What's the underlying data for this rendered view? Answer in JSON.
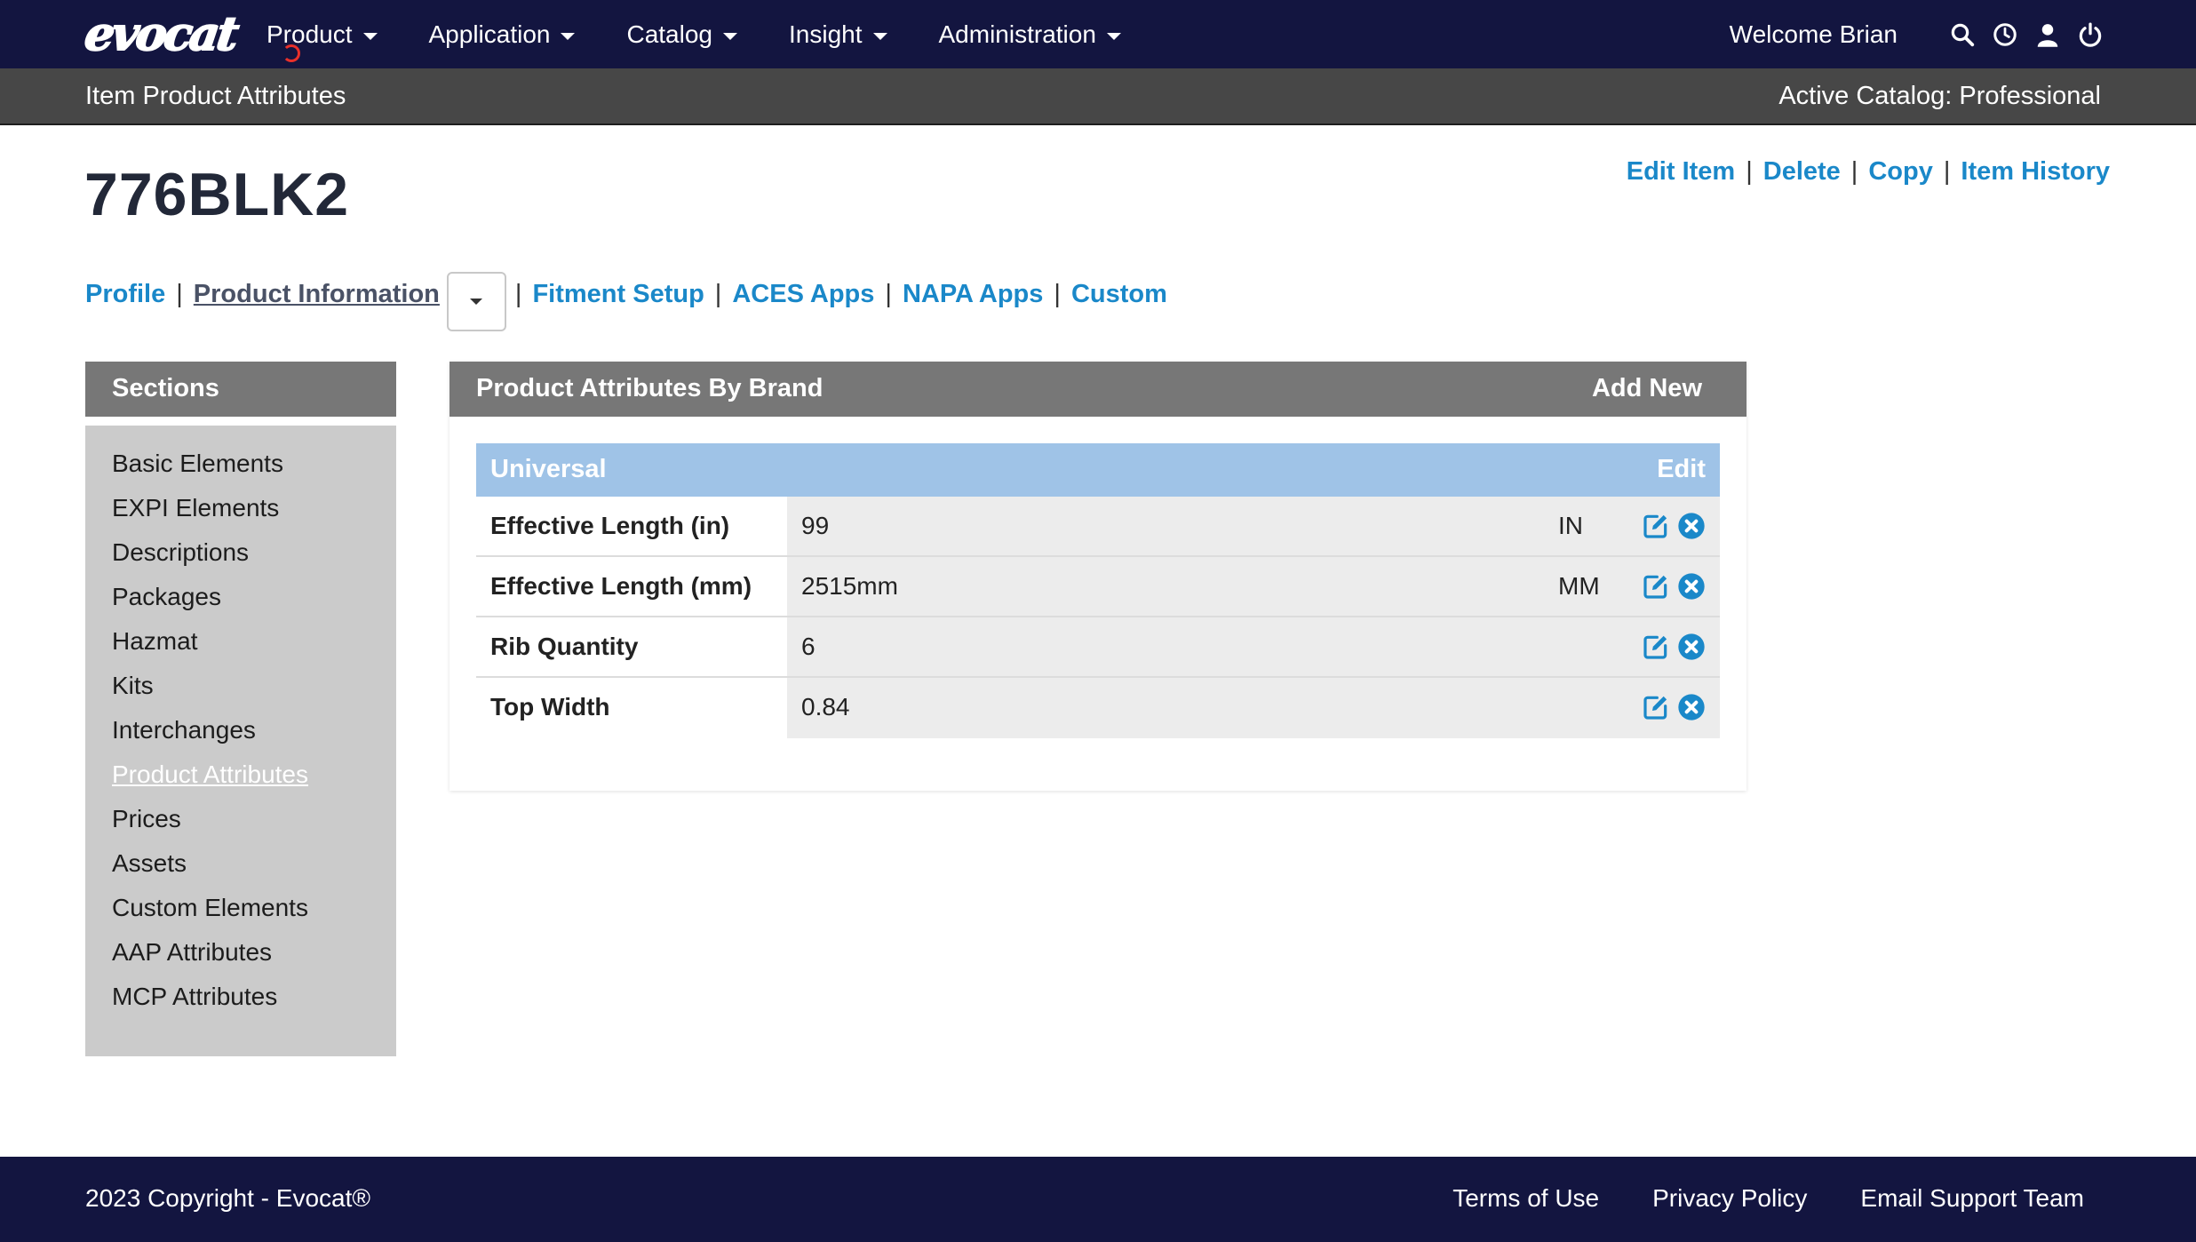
{
  "nav": {
    "logo_text": "evocat",
    "menu": [
      {
        "label": "Product"
      },
      {
        "label": "Application"
      },
      {
        "label": "Catalog"
      },
      {
        "label": "Insight"
      },
      {
        "label": "Administration"
      }
    ],
    "welcome": "Welcome Brian",
    "icons": [
      "search-icon",
      "history-icon",
      "user-icon",
      "power-icon"
    ]
  },
  "subheader": {
    "title": "Item Product Attributes",
    "active_catalog": "Active Catalog: Professional"
  },
  "item": {
    "number": "776BLK2",
    "actions": {
      "edit": "Edit Item",
      "delete": "Delete",
      "copy": "Copy",
      "history": "Item History"
    }
  },
  "tabs": {
    "profile": "Profile",
    "product_information": "Product Information",
    "fitment_setup": "Fitment Setup",
    "aces_apps": "ACES Apps",
    "napa_apps": "NAPA Apps",
    "custom": "Custom"
  },
  "sections": {
    "title": "Sections",
    "items": [
      {
        "label": "Basic Elements"
      },
      {
        "label": "EXPI Elements"
      },
      {
        "label": "Descriptions"
      },
      {
        "label": "Packages"
      },
      {
        "label": "Hazmat"
      },
      {
        "label": "Kits"
      },
      {
        "label": "Interchanges"
      },
      {
        "label": "Product Attributes"
      },
      {
        "label": "Prices"
      },
      {
        "label": "Assets"
      },
      {
        "label": "Custom Elements"
      },
      {
        "label": "AAP Attributes"
      },
      {
        "label": "MCP Attributes"
      }
    ],
    "active": "Product Attributes"
  },
  "panel": {
    "title": "Product Attributes By Brand",
    "add_new": "Add New",
    "brand": {
      "name": "Universal",
      "edit": "Edit",
      "rows": [
        {
          "name": "Effective Length (in)",
          "value": "99",
          "unit": "IN"
        },
        {
          "name": "Effective Length (mm)",
          "value": "2515mm",
          "unit": "MM"
        },
        {
          "name": "Rib Quantity",
          "value": "6",
          "unit": ""
        },
        {
          "name": "Top Width",
          "value": "0.84",
          "unit": ""
        }
      ]
    }
  },
  "footer": {
    "copyright": "2023 Copyright - Evocat®",
    "links": [
      {
        "label": "Terms of Use"
      },
      {
        "label": "Privacy Policy"
      },
      {
        "label": "Email Support Team"
      }
    ]
  },
  "colors": {
    "nav_bg": "#131540",
    "subbar_bg": "#474747",
    "link": "#1a88c9",
    "panel_head": "#777777",
    "brand_head": "#9fc3e7",
    "sidebar_bg": "#cbcbcb"
  }
}
